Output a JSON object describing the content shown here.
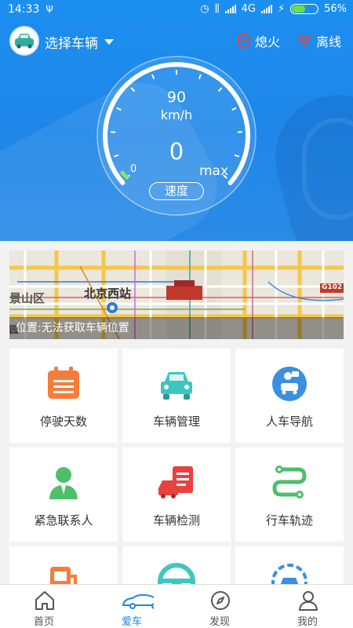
{
  "status": {
    "time": "14:33",
    "network": "4G",
    "battery": "56%",
    "battery_level": 0.56
  },
  "header": {
    "select_car": "选择车辆",
    "engine_status": "熄火",
    "connection_status": "离线"
  },
  "gauge": {
    "top_value": "90",
    "unit": "km/h",
    "speed": "0",
    "min_label": "0",
    "max_label": "max",
    "button_label": "速度"
  },
  "map": {
    "labels": [
      "景山区",
      "北京西站",
      "G102",
      "园"
    ],
    "location_text": "位置:无法获取车辆位置"
  },
  "grid": [
    {
      "label": "停驶天数",
      "icon": "calendar-icon"
    },
    {
      "label": "车辆管理",
      "icon": "car-icon"
    },
    {
      "label": "人车导航",
      "icon": "navigation-icon"
    },
    {
      "label": "紧急联系人",
      "icon": "contact-person-icon"
    },
    {
      "label": "车辆检测",
      "icon": "vehicle-check-icon"
    },
    {
      "label": "行车轨迹",
      "icon": "track-icon"
    },
    {
      "label": "",
      "icon": "fuel-icon"
    },
    {
      "label": "",
      "icon": "steering-wheel-icon"
    },
    {
      "label": "",
      "icon": "car-service-icon"
    }
  ],
  "nav": {
    "items": [
      {
        "label": "首页",
        "icon": "home-icon"
      },
      {
        "label": "爱车",
        "icon": "car-outline-icon"
      },
      {
        "label": "发现",
        "icon": "compass-icon"
      },
      {
        "label": "我的",
        "icon": "user-icon"
      }
    ],
    "active_index": 1
  },
  "colors": {
    "primary": "#1f86e8",
    "orange": "#f57c3a",
    "teal": "#3ec6c0",
    "green": "#4cbf6a",
    "red": "#e8423f"
  }
}
